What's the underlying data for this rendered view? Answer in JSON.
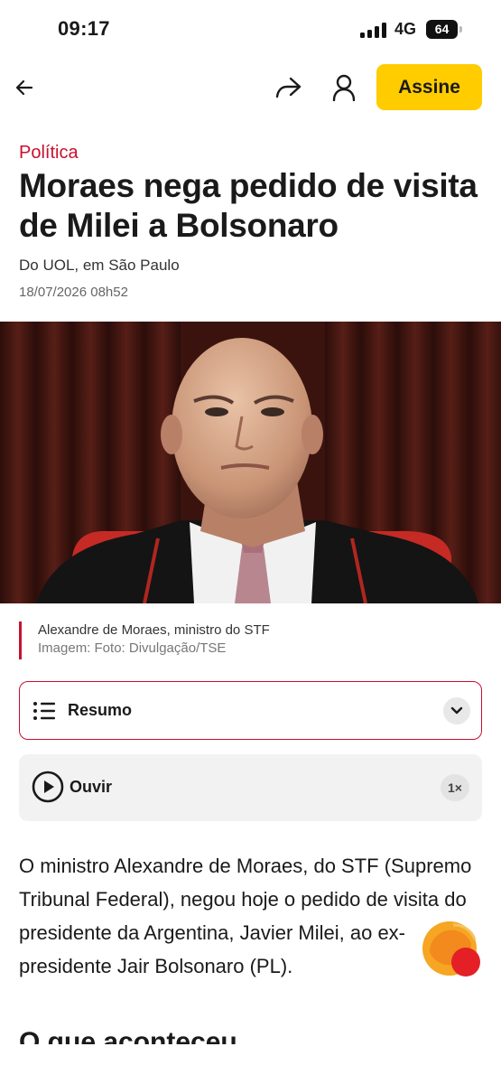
{
  "status_bar": {
    "time": "09:17",
    "network": "4G",
    "battery": "64"
  },
  "nav": {
    "back_icon": "arrow-left-icon",
    "share_icon": "share-forward-icon",
    "account_icon": "user-icon",
    "subscribe_label": "Assine",
    "accent_color": "#ffcc00"
  },
  "article": {
    "category": "Política",
    "headline": "Moraes nega pedido de visita de Milei a Bolsonaro",
    "byline": "Do UOL, em São Paulo",
    "date": "18/07/2026 08h52",
    "brand_color": "#c8102e"
  },
  "image": {
    "caption": "Alexandre de Moraes, ministro do STF",
    "credit": "Imagem: Foto: Divulgação/TSE"
  },
  "summary": {
    "label": "Resumo",
    "icon": "list-icon",
    "toggle_icon": "chevron-down-icon"
  },
  "audio": {
    "label": "Ouvir",
    "icon": "play-icon",
    "speed": "1×"
  },
  "body": {
    "paragraph": "O ministro Alexandre de Moraes, do STF (Supremo Tribunal Federal), negou hoje o pedido de visita do presidente da Argentina, Javier Milei, ao ex-presidente Jair Bolsonaro (PL).",
    "section_heading": "O que aconteceu"
  }
}
